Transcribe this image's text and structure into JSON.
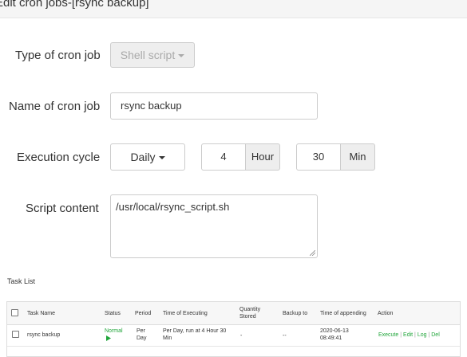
{
  "window": {
    "title": "Edit cron jobs-[rsync backup]"
  },
  "form": {
    "type_label": "Type of cron job",
    "type_value": "Shell script",
    "name_label": "Name of cron job",
    "name_value": "rsync backup",
    "cycle_label": "Execution cycle",
    "cycle_value": "Daily",
    "hour_value": "4",
    "hour_unit": "Hour",
    "min_value": "30",
    "min_unit": "Min",
    "script_label": "Script content",
    "script_value": "/usr/local/rsync_script.sh"
  },
  "task_list": {
    "label": "Task List",
    "headers": {
      "name": "Task Name",
      "status": "Status",
      "period": "Period",
      "time": "Time of Executing",
      "qty1": "Quantity",
      "qty2": "Stored",
      "backup": "Backup to",
      "append": "Time of appending",
      "action": "Action"
    },
    "rows": [
      {
        "name": "rsync backup",
        "status": "Normal",
        "period1": "Per",
        "period2": "Day",
        "time1": "Per Day, run at 4 Hour 30",
        "time2": "Min",
        "qty": "-",
        "backup": "--",
        "append1": "2020-06-13",
        "append2": "08:49:41",
        "execute": "Execute",
        "edit": "Edit",
        "log": "Log",
        "del": "Del",
        "sep": "|"
      }
    ]
  },
  "colors": {
    "accent_green": "#20a53a"
  }
}
